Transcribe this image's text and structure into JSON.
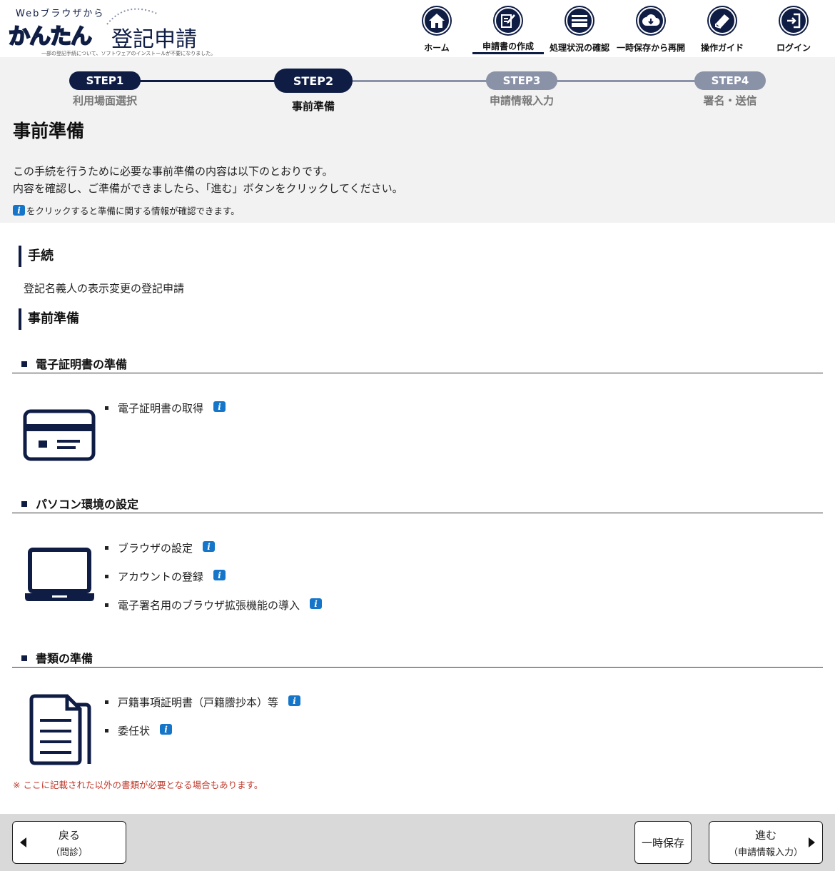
{
  "logo": {
    "top_text": "Webブラウザから",
    "kana": "かんたん",
    "kanji": "登記申請",
    "sub_text": "一部の登記手続について、ソフトウェアのインストールが不要になりました。"
  },
  "nav": {
    "items": [
      {
        "label": "ホーム",
        "icon": "home-icon"
      },
      {
        "label": "申請書の作成",
        "icon": "edit-icon",
        "active": true
      },
      {
        "label": "処理状況の確認",
        "icon": "tray-icon"
      },
      {
        "label": "一時保存から再開",
        "icon": "cloud-download-icon"
      },
      {
        "label": "操作ガイド",
        "icon": "book-icon"
      },
      {
        "label": "ログイン",
        "icon": "login-icon"
      }
    ]
  },
  "steps": [
    {
      "label": "STEP1",
      "caption": "利用場面選択",
      "state": "done"
    },
    {
      "label": "STEP2",
      "caption": "事前準備",
      "state": "current"
    },
    {
      "label": "STEP3",
      "caption": "申請情報入力",
      "state": "todo"
    },
    {
      "label": "STEP4",
      "caption": "署名・送信",
      "state": "todo"
    }
  ],
  "page": {
    "title": "事前準備",
    "intro_line1": "この手続を行うために必要な事前準備の内容は以下のとおりです。",
    "intro_line2": "内容を確認し、ご準備ができましたら、「進む」ボタンをクリックしてください。",
    "intro_note": "をクリックすると準備に関する情報が確認できます。",
    "info_glyph": "i"
  },
  "procedure": {
    "heading": "手続",
    "value": "登記名義人の表示変更の登記申請"
  },
  "preparation": {
    "heading": "事前準備",
    "sections": [
      {
        "title": "電子証明書の準備",
        "icon": "id-card-icon",
        "items": [
          "電子証明書の取得"
        ]
      },
      {
        "title": "パソコン環境の設定",
        "icon": "laptop-icon",
        "items": [
          "ブラウザの設定",
          "アカウントの登録",
          "電子署名用のブラウザ拡張機能の導入"
        ]
      },
      {
        "title": "書類の準備",
        "icon": "documents-icon",
        "items": [
          "戸籍事項証明書（戸籍謄抄本）等",
          "委任状"
        ]
      }
    ],
    "note": "※ ここに記載された以外の書類が必要となる場合もあります。"
  },
  "footer": {
    "back": {
      "line1": "戻る",
      "line2": "（問診）"
    },
    "save": {
      "line1": "一時保存"
    },
    "next": {
      "line1": "進む",
      "line2": "（申請情報入力）"
    }
  },
  "colors": {
    "primary": "#0f1d45",
    "step_todo": "#8a92a8",
    "info": "#1576c9",
    "note": "#c0392b",
    "band": "#f2f2f2",
    "footer": "#d9d9d9"
  }
}
